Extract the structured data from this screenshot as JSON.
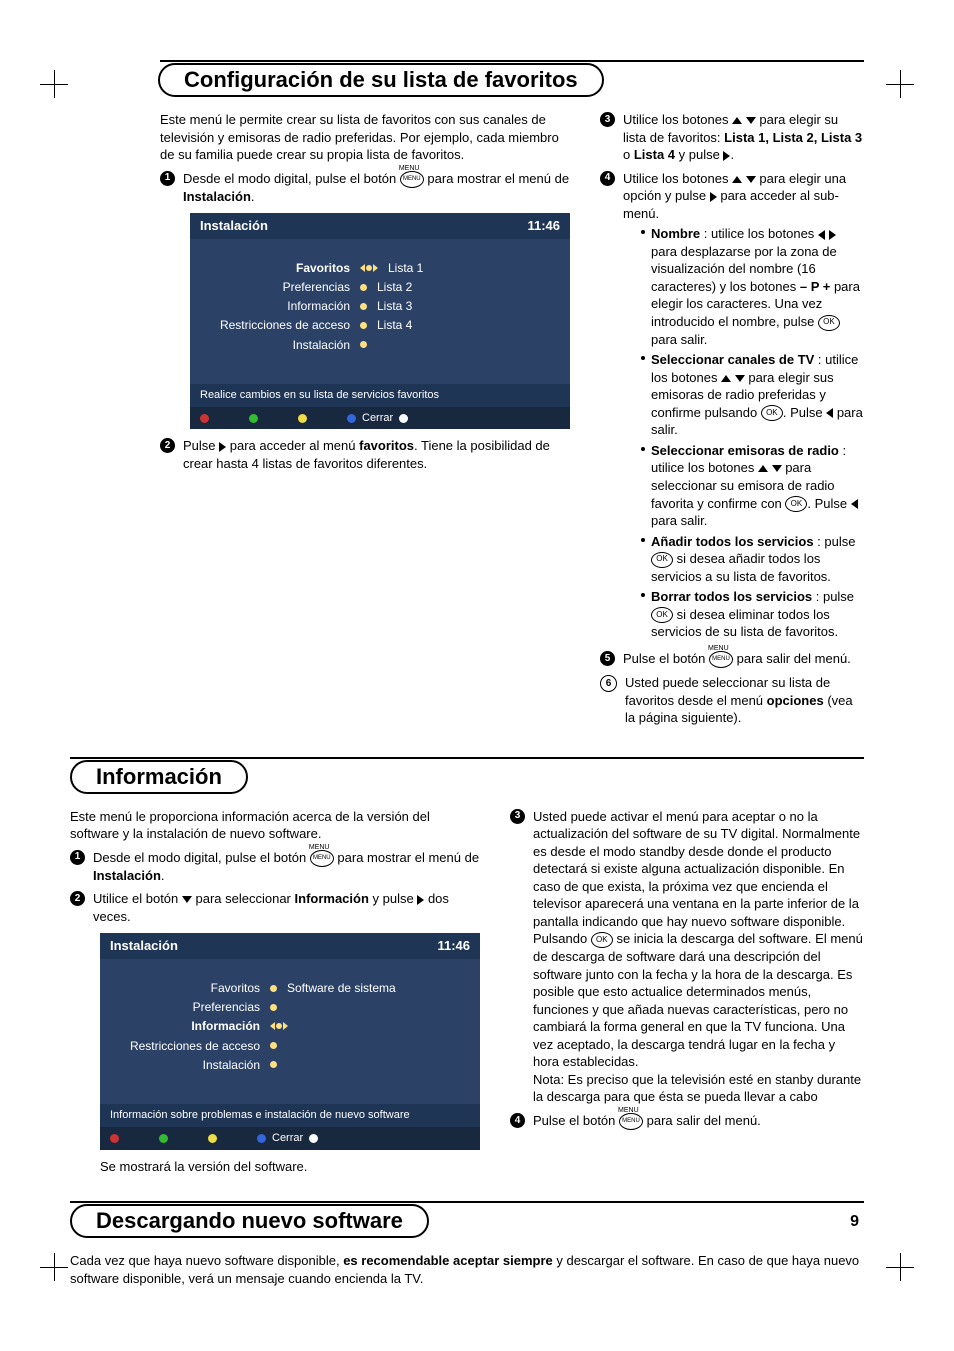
{
  "page_number": "9",
  "sections": {
    "favoritos": {
      "title": "Configuración de su lista de favoritos",
      "intro": "Este menú le permite crear su lista de favoritos con sus canales de televisión y emisoras de radio preferidas. Por ejemplo, cada miembro de su familia puede crear su propia lista de favoritos.",
      "step1_a": "Desde el modo digital, pulse el botón ",
      "step1_b": " para mostrar el menú de ",
      "step1_bold": "Instalación",
      "step1_end": ".",
      "step2_a": "Pulse ",
      "step2_b": " para acceder al menú ",
      "step2_bold": "favoritos",
      "step2_end": ". Tiene la posibilidad de crear hasta 4 listas de favoritos diferentes.",
      "step3_a": "Utilice los botones ",
      "step3_b": " para elegir su lista de favoritos: ",
      "step3_lists": "Lista 1, Lista 2, Lista 3",
      "step3_or": " o ",
      "step3_last": "Lista 4",
      "step3_end": " y pulse ",
      "step3_period": ".",
      "step4_a": "Utilice los botones ",
      "step4_b": " para elegir una opción y pulse ",
      "step4_c": " para acceder al sub-menú.",
      "opt_nombre_label": "Nombre",
      "opt_nombre_a": " : utilice los botones ",
      "opt_nombre_b": " para desplazarse por la zona de visualización del nombre (16 caracteres) y los botones ",
      "opt_nombre_bold": "– P +",
      "opt_nombre_c": " para elegir los caracteres. Una vez introducido el nombre, pulse ",
      "opt_nombre_d": " para salir.",
      "opt_canales_label": "Seleccionar canales de TV",
      "opt_canales_a": " : utilice los botones ",
      "opt_canales_b": " para elegir sus emisoras de radio preferidas y confirme pulsando ",
      "opt_canales_c": ". Pulse ",
      "opt_canales_d": " para salir.",
      "opt_emisoras_label": "Seleccionar emisoras de radio",
      "opt_emisoras_a": " : utilice los botones ",
      "opt_emisoras_b": " para seleccionar su emisora de radio favorita y confirme con ",
      "opt_emisoras_c": ". Pulse ",
      "opt_emisoras_d": "  para salir.",
      "opt_anadir_label": "Añadir todos los servicios",
      "opt_anadir_a": " : pulse ",
      "opt_anadir_b": " si desea añadir todos los servicios a su lista de favoritos.",
      "opt_borrar_label": "Borrar todos los servicios",
      "opt_borrar_a": " : pulse ",
      "opt_borrar_b": " si desea eliminar todos los servicios de su lista de favoritos.",
      "step5_a": "Pulse el botón ",
      "step5_b": " para salir del menú.",
      "step6_a": "Usted puede seleccionar su lista de favoritos desde el menú ",
      "step6_bold": "opciones",
      "step6_b": " (vea la página siguiente)."
    },
    "informacion": {
      "title": "Información",
      "intro": "Este menú le proporciona información acerca de la versión del software y la instalación de nuevo software.",
      "step1_a": "Desde el modo digital, pulse el botón ",
      "step1_b": " para mostrar el menú de ",
      "step1_bold": "Instalación",
      "step1_end": ".",
      "step2_a": "Utilice el botón ",
      "step2_b": " para seleccionar ",
      "step2_bold": "Información",
      "step2_c": " y pulse ",
      "step2_d": " dos veces.",
      "caption": "Se mostrará la versión del software.",
      "step3": "Usted puede activar el menú para aceptar o no la actualización del software de su TV digital. Normalmente es desde el modo standby desde donde el producto detectará si existe alguna actualización disponible. En caso de que exista, la próxima vez que encienda el televisor aparecerá una ventana en la parte inferior de la pantalla indicando que hay nuevo software disponible. Pulsando ",
      "step3_b": " se inicia la descarga del software. El menú de descarga de software dará una descripción del software junto con la fecha y la hora de la descarga. Es posible que esto actualice determinados menús, funciones y que añada nuevas características, pero no cambiará la forma general en que la TV funciona. Una vez aceptado, la descarga tendrá lugar en la fecha y hora establecidas.",
      "note": "Nota: Es preciso que la televisión esté en stanby durante la descarga para que ésta se pueda llevar a cabo",
      "step4_a": "Pulse el botón ",
      "step4_b": " para salir del menú."
    },
    "descarga": {
      "title": "Descargando nuevo software",
      "body_a": "Cada vez que haya nuevo software disponible, ",
      "body_bold": "es recomendable aceptar siempre",
      "body_b": " y descargar el software. En caso de que haya nuevo software disponible, verá  un mensaje cuando encienda la TV."
    }
  },
  "ui1": {
    "title": "Instalación",
    "time": "11:46",
    "items": [
      "Favoritos",
      "Preferencias",
      "Información",
      "Restricciones de acceso",
      "Instalación"
    ],
    "right": [
      "Lista 1",
      "Lista 2",
      "Lista 3",
      "Lista 4"
    ],
    "footer_msg": "Realice cambios en su lista de servicios favoritos",
    "close": "Cerrar"
  },
  "ui2": {
    "title": "Instalación",
    "time": "11:46",
    "items": [
      "Favoritos",
      "Preferencias",
      "Información",
      "Restricciones de acceso",
      "Instalación"
    ],
    "right": "Software de sistema",
    "footer_msg": "Información sobre problemas e instalación de nuevo software",
    "close": "Cerrar"
  }
}
